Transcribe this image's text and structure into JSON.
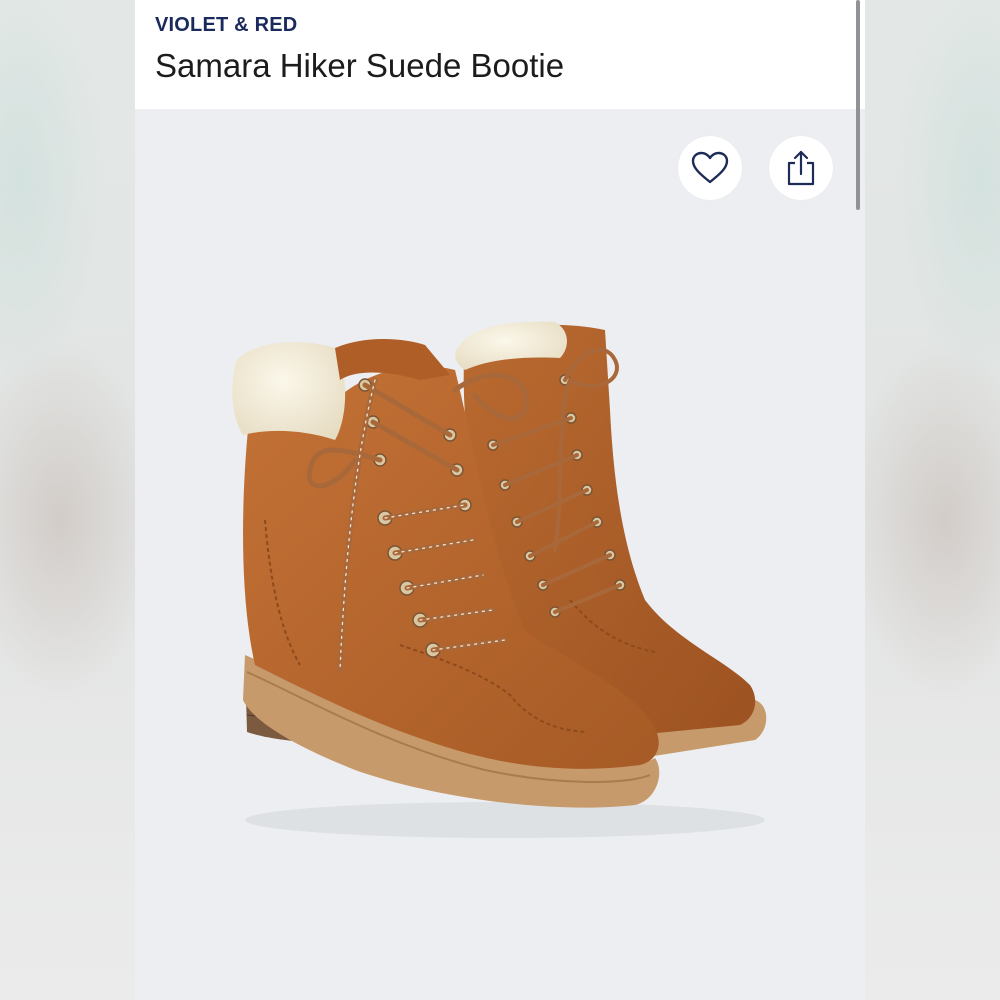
{
  "product": {
    "brand": "VIOLET & RED",
    "title": "Samara Hiker Suede Bootie"
  },
  "actions": {
    "favorite_icon": "heart-outline-icon",
    "share_icon": "share-up-arrow-icon"
  },
  "image": {
    "subject": "product-photo",
    "colors": {
      "suede": "#b5652b",
      "suede_dark": "#8e4a1c",
      "shearling": "#f3ecd9",
      "sole": "#c79a6b",
      "heel": "#7b5a40",
      "eyelet": "#d9c7a2",
      "lace": "#a8683a"
    }
  },
  "colors": {
    "brand_text": "#1b2a5c",
    "title_text": "#1c1c1c",
    "page_bg": "#eceef1",
    "header_bg": "#ffffff"
  }
}
